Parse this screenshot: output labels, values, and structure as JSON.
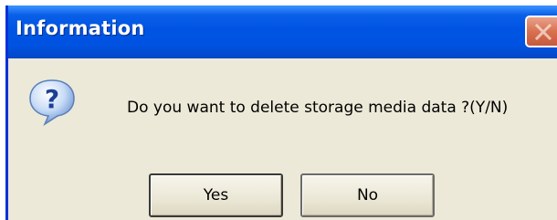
{
  "window": {
    "title": "Information",
    "close_icon": "close-icon"
  },
  "dialog": {
    "icon": "question-icon",
    "message": "Do you want to delete storage media data ?(Y/N)"
  },
  "buttons": {
    "yes_label": "Yes",
    "no_label": "No"
  },
  "colors": {
    "titlebar": "#0054e3",
    "dialog_background": "#ece9d8",
    "close_button": "#d9704f",
    "icon_bubble": "#2f6fd6"
  }
}
